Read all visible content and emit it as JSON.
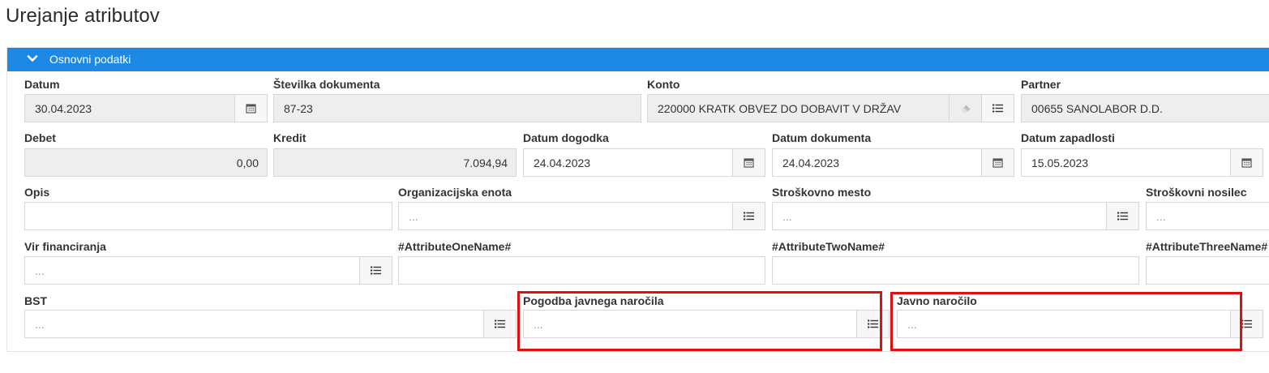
{
  "page": {
    "title": "Urejanje atributov"
  },
  "section": {
    "title": "Osnovni podatki"
  },
  "fields": {
    "datum": {
      "label": "Datum",
      "value": "30.04.2023"
    },
    "stevilka": {
      "label": "Številka dokumenta",
      "value": "87-23"
    },
    "konto": {
      "label": "Konto",
      "value": "220000 KRATK OBVEZ DO DOBAVIT V DRŽAV"
    },
    "partner": {
      "label": "Partner",
      "value": "00655 SANOLABOR D.D."
    },
    "debet": {
      "label": "Debet",
      "value": "0,00"
    },
    "kredit": {
      "label": "Kredit",
      "value": "7.094,94"
    },
    "datum_dogodka": {
      "label": "Datum dogodka",
      "value": "24.04.2023"
    },
    "datum_dokumenta": {
      "label": "Datum dokumenta",
      "value": "24.04.2023"
    },
    "datum_zapadlosti": {
      "label": "Datum zapadlosti",
      "value": "15.05.2023"
    },
    "opis": {
      "label": "Opis",
      "value": ""
    },
    "org_enota": {
      "label": "Organizacijska enota",
      "placeholder": "..."
    },
    "str_mesto": {
      "label": "Stroškovno mesto",
      "placeholder": "..."
    },
    "str_nosilec": {
      "label": "Stroškovni nosilec",
      "placeholder": "..."
    },
    "vir": {
      "label": "Vir financiranja",
      "placeholder": "..."
    },
    "attr_one": {
      "label": "#AttributeOneName#",
      "value": ""
    },
    "attr_two": {
      "label": "#AttributeTwoName#",
      "value": ""
    },
    "attr_three": {
      "label": "#AttributeThreeName#",
      "value": ""
    },
    "bst": {
      "label": "BST",
      "placeholder": "..."
    },
    "pogodba": {
      "label": "Pogodba javnega naročila",
      "placeholder": "..."
    },
    "javno": {
      "label": "Javno naročilo",
      "placeholder": "..."
    }
  },
  "icons": {
    "calendar": "calendar-icon",
    "list": "list-icon",
    "eraser": "eraser-icon",
    "chevron": "chevron-down-icon"
  },
  "colors": {
    "header": "#1e88e5",
    "highlight": "#e01010",
    "readonly": "#eeeeee"
  }
}
